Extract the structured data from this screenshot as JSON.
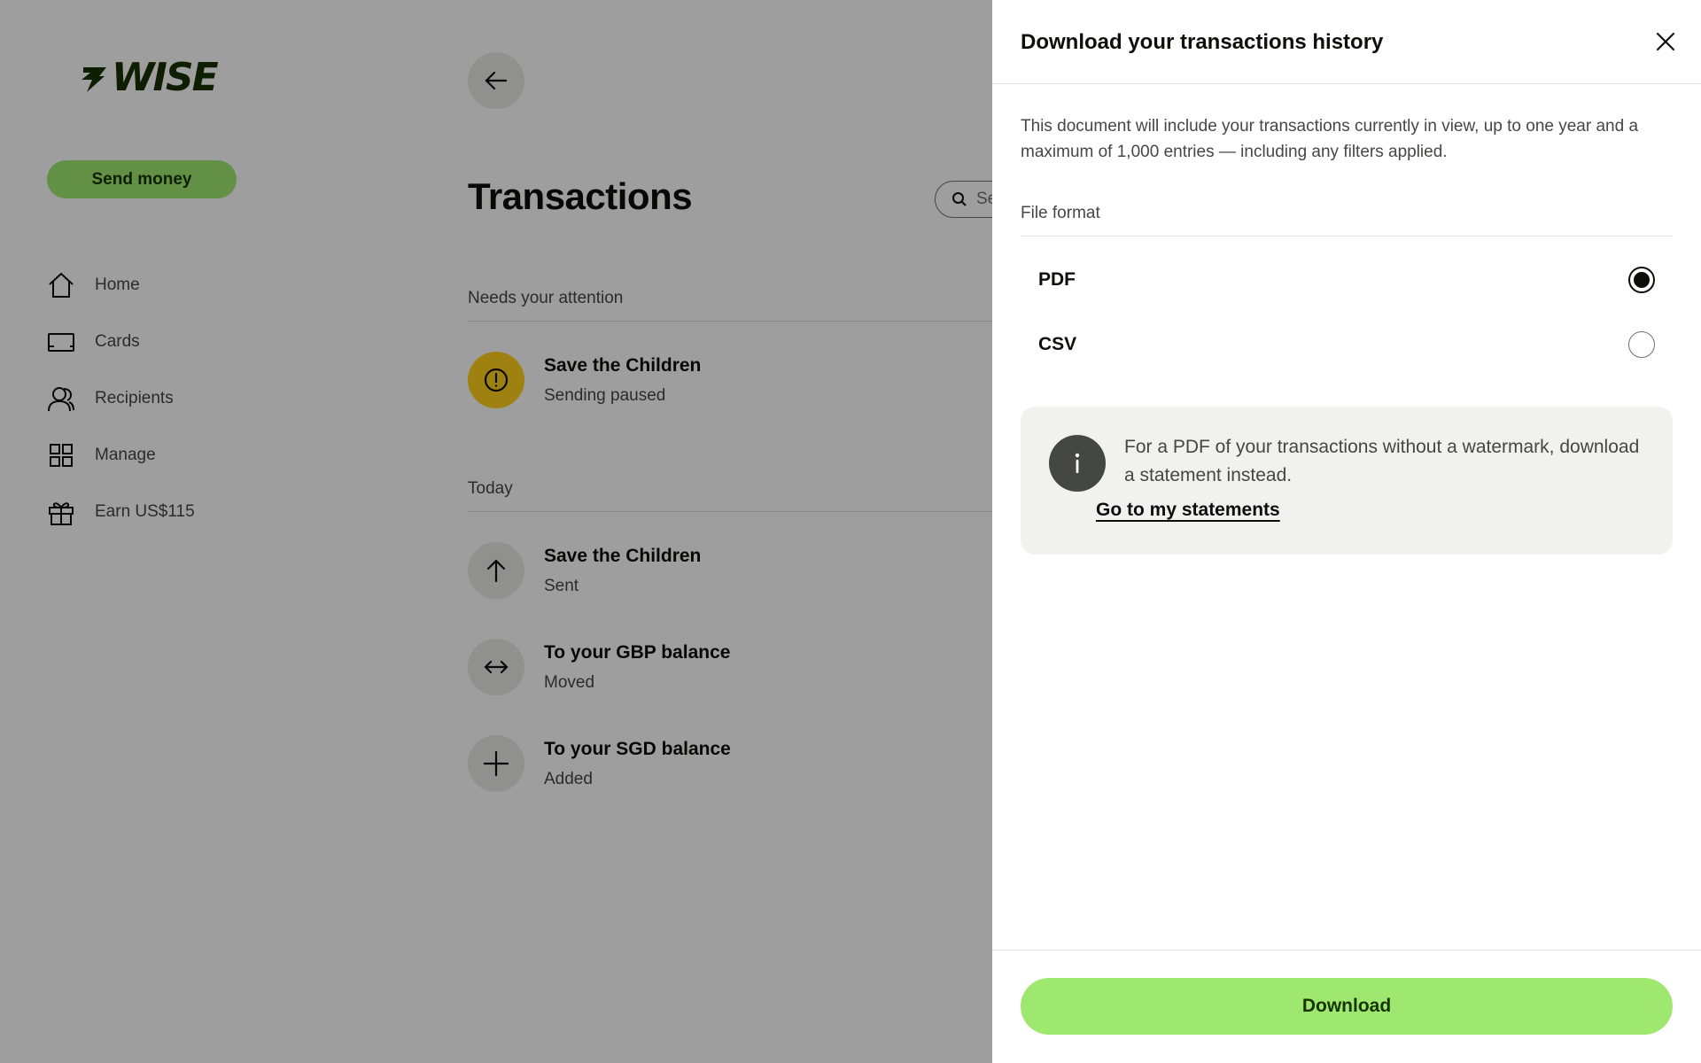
{
  "brand": {
    "logo_text": "WISE",
    "accent_color": "#9fe870",
    "dark_color": "#163300"
  },
  "sidebar": {
    "send_money_label": "Send money",
    "items": [
      {
        "label": "Home",
        "icon": "home-icon"
      },
      {
        "label": "Cards",
        "icon": "card-icon"
      },
      {
        "label": "Recipients",
        "icon": "recipients-icon"
      },
      {
        "label": "Manage",
        "icon": "grid-icon"
      },
      {
        "label": "Earn US$115",
        "icon": "gift-icon"
      }
    ]
  },
  "main": {
    "title": "Transactions",
    "search_placeholder": "Se",
    "sections": [
      {
        "heading": "Needs your attention",
        "items": [
          {
            "title": "Save the Children",
            "subtitle": "Sending paused",
            "icon": "alert-icon"
          }
        ]
      },
      {
        "heading": "Today",
        "items": [
          {
            "title": "Save the Children",
            "subtitle": "Sent",
            "icon": "arrow-up-icon"
          },
          {
            "title": "To your GBP balance",
            "subtitle": "Moved",
            "icon": "swap-icon"
          },
          {
            "title": "To your SGD balance",
            "subtitle": "Added",
            "icon": "plus-icon"
          }
        ]
      }
    ]
  },
  "drawer": {
    "title": "Download your transactions history",
    "description": "This document will include your transactions currently in view, up to one year and a maximum of 1,000 entries — including any filters applied.",
    "file_format_label": "File format",
    "options": [
      {
        "label": "PDF",
        "selected": true
      },
      {
        "label": "CSV",
        "selected": false
      }
    ],
    "info": {
      "text": "For a PDF of your transactions without a watermark, download a statement instead.",
      "link_label": "Go to my statements"
    },
    "download_label": "Download"
  }
}
